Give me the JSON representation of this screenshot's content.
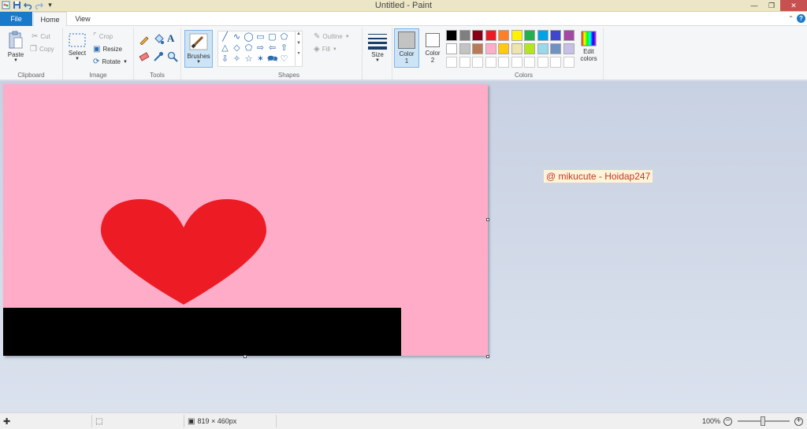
{
  "window": {
    "title": "Untitled - Paint"
  },
  "tabs": {
    "file": "File",
    "home": "Home",
    "view": "View"
  },
  "clipboard": {
    "paste": "Paste",
    "cut": "Cut",
    "copy": "Copy",
    "label": "Clipboard"
  },
  "image": {
    "select": "Select",
    "crop": "Crop",
    "resize": "Resize",
    "rotate": "Rotate",
    "label": "Image"
  },
  "tools": {
    "label": "Tools"
  },
  "brushes": {
    "label": "Brushes"
  },
  "shapes": {
    "outline": "Outline",
    "fill": "Fill",
    "label": "Shapes"
  },
  "size": {
    "label": "Size"
  },
  "color1": {
    "label": "Color",
    "num": "1",
    "value": "#c3c3c3"
  },
  "color2": {
    "label": "Color",
    "num": "2",
    "value": "#ffffff"
  },
  "colors": {
    "label": "Colors",
    "edit_label_1": "Edit",
    "edit_label_2": "colors",
    "row1": [
      "#000000",
      "#7f7f7f",
      "#880015",
      "#ed1c24",
      "#ff7f27",
      "#fff200",
      "#22b14c",
      "#00a2e8",
      "#3f48cc",
      "#a349a4"
    ],
    "row2": [
      "#ffffff",
      "#c3c3c3",
      "#b97a57",
      "#ffaec9",
      "#ffc90e",
      "#efe4b0",
      "#b5e61d",
      "#99d9ea",
      "#7092be",
      "#c8bfe7"
    ]
  },
  "canvas": {
    "background": "#feacc8",
    "heart_color": "#ed1c24"
  },
  "watermark": "@ mikucute - Hoidap247",
  "status": {
    "size": "819 × 460px",
    "zoom": "100%"
  }
}
